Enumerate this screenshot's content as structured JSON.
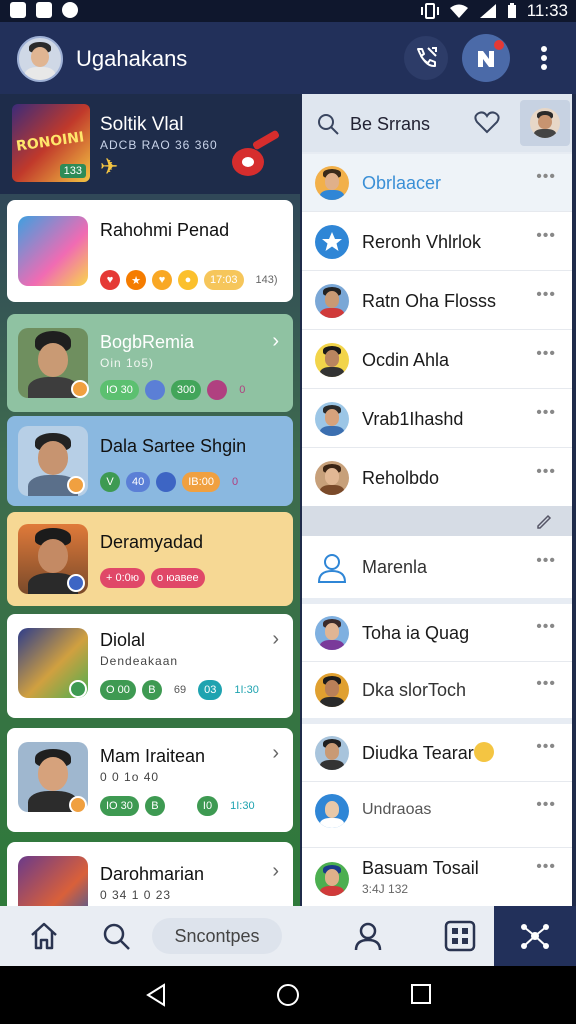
{
  "status_bar": {
    "time": "11:33"
  },
  "header": {
    "title": "Ugahakans"
  },
  "featured": {
    "title": "Soltik Vlal",
    "subtitle": "ADCB RAO 36 360",
    "thumb_text": "RONOINI",
    "thumb_badge": "133"
  },
  "left_cards": [
    {
      "title": "Rahohmi Penad",
      "subtitle": "",
      "chips": [
        "",
        "",
        "",
        "",
        "17:03",
        "143)"
      ],
      "bg": "#ffffff"
    },
    {
      "title": "BogbRemia",
      "subtitle": "Oin 1o5)",
      "chips": [
        "IO 30",
        "",
        "300",
        "",
        "0"
      ],
      "bg": "#8fc2a2"
    },
    {
      "title": "Dala Sartee Shgin",
      "subtitle": "",
      "chips": [
        "V",
        "40",
        "",
        "IB:00",
        "0"
      ],
      "bg": "#8ab8e0"
    },
    {
      "title": "Deramyadad",
      "subtitle": "",
      "chips": [
        "+ 0:0ю",
        "о юaвee"
      ],
      "bg": "#f6d894"
    },
    {
      "title": "Diolal",
      "subtitle": "Dendeakaan",
      "chips": [
        "O 00",
        "B",
        "69",
        "03",
        "1I:30"
      ],
      "bg": "#ffffff"
    },
    {
      "title": "Mam Iraitean",
      "subtitle": "0 0 1o 40",
      "chips": [
        "IO 30",
        "B",
        "",
        "I0",
        "1I:30"
      ],
      "bg": "#ffffff"
    },
    {
      "title": "Darohmarian",
      "subtitle": "0 34 1 0 23",
      "chips": [],
      "bg": "#ffffff"
    }
  ],
  "right_panel": {
    "search_text": "Be Srrans",
    "contacts": [
      {
        "name": "Obrlaacer",
        "color": "#3a8fd6"
      },
      {
        "name": "Reronh Vhlrlok",
        "color": "#1a1a1a"
      },
      {
        "name": "Ratn Oha Flosss",
        "color": "#1a1a1a"
      },
      {
        "name": "Ocdin Ahla",
        "color": "#1a1a1a"
      },
      {
        "name": "Vrab1Ihashd",
        "color": "#1a1a1a"
      },
      {
        "name": "Reholbdo",
        "color": "#1a1a1a"
      },
      {
        "name": "Marenla",
        "color": "#1a1a1a"
      },
      {
        "name": "Toha ia Quag",
        "color": "#1a1a1a"
      },
      {
        "name": "Dka slorToch",
        "color": "#1a1a1a"
      },
      {
        "name": "Diudka Tearar",
        "color": "#1a1a1a"
      },
      {
        "name": "Undraoas",
        "color": "#1a1a1a"
      },
      {
        "name": "Basuam Tosail",
        "color": "#1a1a1a",
        "sub": "3:4J 132"
      }
    ],
    "more_glyph": "•••"
  },
  "bottom_nav": {
    "search_label": "Sncontpes"
  }
}
